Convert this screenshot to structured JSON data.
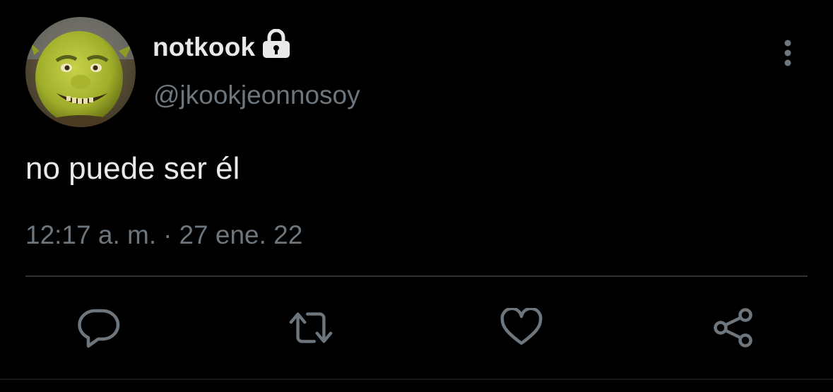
{
  "tweet": {
    "display_name": "notkook",
    "handle": "@jkookjeonnosoy",
    "text": "no puede ser él",
    "time": "12:17 a. m.",
    "separator": "·",
    "date": "27 ene. 22",
    "protected": true
  },
  "icons": {
    "lock": "lock-icon",
    "more": "more-vertical-icon",
    "reply": "reply-bubble-icon",
    "retweet": "retweet-icon",
    "like": "heart-icon",
    "share": "share-icon"
  },
  "colors": {
    "background": "#000000",
    "primary_text": "#e7e9ea",
    "secondary_text": "#6e767d",
    "divider": "#2f3336"
  }
}
